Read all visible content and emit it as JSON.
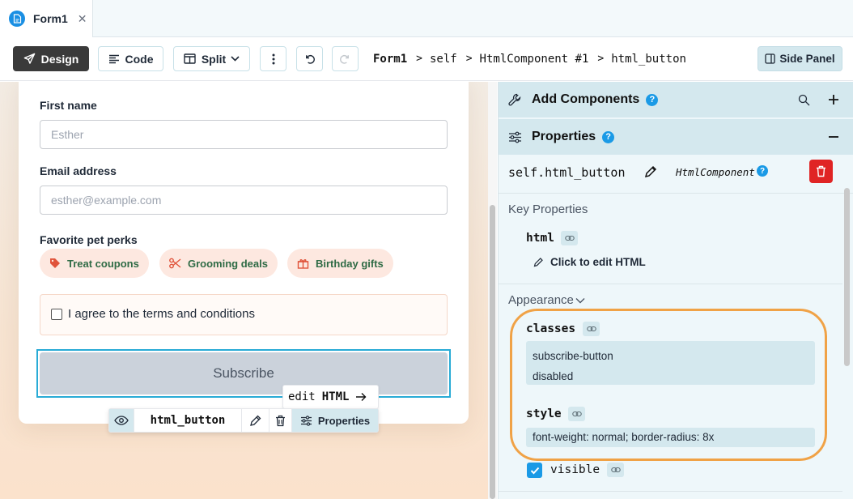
{
  "tab": {
    "label": "Form1",
    "close": "✕"
  },
  "toolbar": {
    "design": "Design",
    "code": "Code",
    "split": "Split",
    "side_panel": "Side Panel",
    "breadcrumb": [
      "Form1",
      "self",
      "HtmlComponent #1",
      "html_button"
    ]
  },
  "form": {
    "first_name_label": "First name",
    "first_name_placeholder": "Esther",
    "email_label": "Email address",
    "email_placeholder": "esther@example.com",
    "perks_label": "Favorite pet perks",
    "perks": [
      "Treat coupons",
      "Grooming deals",
      "Birthday gifts"
    ],
    "agree_text": "I agree to the terms and conditions",
    "subscribe": "Subscribe"
  },
  "overlay": {
    "edit_html": "edit",
    "edit_html_bold": "HTML",
    "component_name": "html_button",
    "properties": "Properties"
  },
  "panel": {
    "add_components": "Add Components",
    "properties": "Properties",
    "self_name": "self.html_button",
    "component_type": "HtmlComponent",
    "key_properties": "Key Properties",
    "html_label": "html",
    "click_to_edit": "Click to edit HTML",
    "appearance": "Appearance",
    "classes_label": "classes",
    "classes_values": [
      "subscribe-button",
      "disabled"
    ],
    "style_label": "style",
    "style_value": "font-weight: normal; border-radius: 8x",
    "visible_label": "visible"
  },
  "colors": {
    "accent": "#1a9ae6",
    "panel_header": "#d4e8ee",
    "highlight": "#f0a246",
    "danger": "#e02424",
    "chip_bg": "#fde8e0",
    "chip_icon": "#e0533a",
    "chip_text": "#2f6b45"
  }
}
